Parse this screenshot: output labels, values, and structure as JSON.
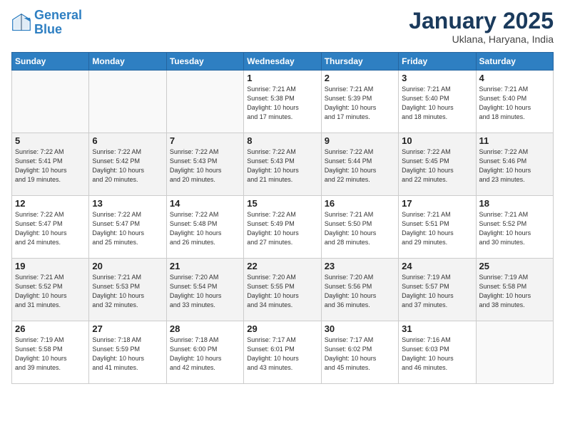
{
  "logo": {
    "text1": "General",
    "text2": "Blue"
  },
  "title": "January 2025",
  "subtitle": "Uklana, Haryana, India",
  "weekdays": [
    "Sunday",
    "Monday",
    "Tuesday",
    "Wednesday",
    "Thursday",
    "Friday",
    "Saturday"
  ],
  "weeks": [
    [
      {
        "day": "",
        "info": ""
      },
      {
        "day": "",
        "info": ""
      },
      {
        "day": "",
        "info": ""
      },
      {
        "day": "1",
        "info": "Sunrise: 7:21 AM\nSunset: 5:38 PM\nDaylight: 10 hours\nand 17 minutes."
      },
      {
        "day": "2",
        "info": "Sunrise: 7:21 AM\nSunset: 5:39 PM\nDaylight: 10 hours\nand 17 minutes."
      },
      {
        "day": "3",
        "info": "Sunrise: 7:21 AM\nSunset: 5:40 PM\nDaylight: 10 hours\nand 18 minutes."
      },
      {
        "day": "4",
        "info": "Sunrise: 7:21 AM\nSunset: 5:40 PM\nDaylight: 10 hours\nand 18 minutes."
      }
    ],
    [
      {
        "day": "5",
        "info": "Sunrise: 7:22 AM\nSunset: 5:41 PM\nDaylight: 10 hours\nand 19 minutes."
      },
      {
        "day": "6",
        "info": "Sunrise: 7:22 AM\nSunset: 5:42 PM\nDaylight: 10 hours\nand 20 minutes."
      },
      {
        "day": "7",
        "info": "Sunrise: 7:22 AM\nSunset: 5:43 PM\nDaylight: 10 hours\nand 20 minutes."
      },
      {
        "day": "8",
        "info": "Sunrise: 7:22 AM\nSunset: 5:43 PM\nDaylight: 10 hours\nand 21 minutes."
      },
      {
        "day": "9",
        "info": "Sunrise: 7:22 AM\nSunset: 5:44 PM\nDaylight: 10 hours\nand 22 minutes."
      },
      {
        "day": "10",
        "info": "Sunrise: 7:22 AM\nSunset: 5:45 PM\nDaylight: 10 hours\nand 22 minutes."
      },
      {
        "day": "11",
        "info": "Sunrise: 7:22 AM\nSunset: 5:46 PM\nDaylight: 10 hours\nand 23 minutes."
      }
    ],
    [
      {
        "day": "12",
        "info": "Sunrise: 7:22 AM\nSunset: 5:47 PM\nDaylight: 10 hours\nand 24 minutes."
      },
      {
        "day": "13",
        "info": "Sunrise: 7:22 AM\nSunset: 5:47 PM\nDaylight: 10 hours\nand 25 minutes."
      },
      {
        "day": "14",
        "info": "Sunrise: 7:22 AM\nSunset: 5:48 PM\nDaylight: 10 hours\nand 26 minutes."
      },
      {
        "day": "15",
        "info": "Sunrise: 7:22 AM\nSunset: 5:49 PM\nDaylight: 10 hours\nand 27 minutes."
      },
      {
        "day": "16",
        "info": "Sunrise: 7:21 AM\nSunset: 5:50 PM\nDaylight: 10 hours\nand 28 minutes."
      },
      {
        "day": "17",
        "info": "Sunrise: 7:21 AM\nSunset: 5:51 PM\nDaylight: 10 hours\nand 29 minutes."
      },
      {
        "day": "18",
        "info": "Sunrise: 7:21 AM\nSunset: 5:52 PM\nDaylight: 10 hours\nand 30 minutes."
      }
    ],
    [
      {
        "day": "19",
        "info": "Sunrise: 7:21 AM\nSunset: 5:52 PM\nDaylight: 10 hours\nand 31 minutes."
      },
      {
        "day": "20",
        "info": "Sunrise: 7:21 AM\nSunset: 5:53 PM\nDaylight: 10 hours\nand 32 minutes."
      },
      {
        "day": "21",
        "info": "Sunrise: 7:20 AM\nSunset: 5:54 PM\nDaylight: 10 hours\nand 33 minutes."
      },
      {
        "day": "22",
        "info": "Sunrise: 7:20 AM\nSunset: 5:55 PM\nDaylight: 10 hours\nand 34 minutes."
      },
      {
        "day": "23",
        "info": "Sunrise: 7:20 AM\nSunset: 5:56 PM\nDaylight: 10 hours\nand 36 minutes."
      },
      {
        "day": "24",
        "info": "Sunrise: 7:19 AM\nSunset: 5:57 PM\nDaylight: 10 hours\nand 37 minutes."
      },
      {
        "day": "25",
        "info": "Sunrise: 7:19 AM\nSunset: 5:58 PM\nDaylight: 10 hours\nand 38 minutes."
      }
    ],
    [
      {
        "day": "26",
        "info": "Sunrise: 7:19 AM\nSunset: 5:58 PM\nDaylight: 10 hours\nand 39 minutes."
      },
      {
        "day": "27",
        "info": "Sunrise: 7:18 AM\nSunset: 5:59 PM\nDaylight: 10 hours\nand 41 minutes."
      },
      {
        "day": "28",
        "info": "Sunrise: 7:18 AM\nSunset: 6:00 PM\nDaylight: 10 hours\nand 42 minutes."
      },
      {
        "day": "29",
        "info": "Sunrise: 7:17 AM\nSunset: 6:01 PM\nDaylight: 10 hours\nand 43 minutes."
      },
      {
        "day": "30",
        "info": "Sunrise: 7:17 AM\nSunset: 6:02 PM\nDaylight: 10 hours\nand 45 minutes."
      },
      {
        "day": "31",
        "info": "Sunrise: 7:16 AM\nSunset: 6:03 PM\nDaylight: 10 hours\nand 46 minutes."
      },
      {
        "day": "",
        "info": ""
      }
    ]
  ]
}
